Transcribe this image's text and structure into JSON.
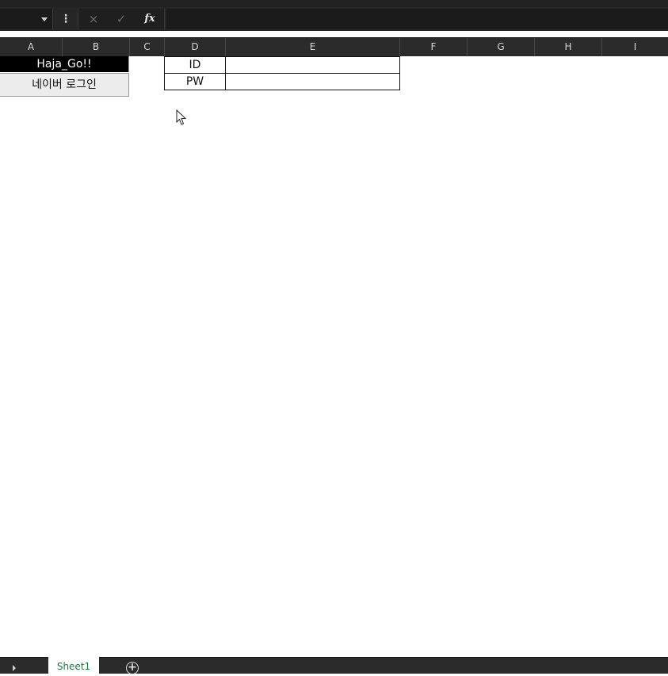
{
  "formula_bar": {
    "cancel_icon": "×",
    "enter_icon": "✓",
    "insert_function_label": "fx",
    "more_icon": "⋮",
    "name_box_value": "",
    "formula_value": ""
  },
  "columns": [
    "A",
    "B",
    "C",
    "D",
    "E",
    "F",
    "G",
    "H",
    "I"
  ],
  "sheet": {
    "button_haja": "Haja_Go!!",
    "button_naver_login": "네이버 로그인",
    "login_table": {
      "id_label": "ID",
      "pw_label": "PW",
      "id_value": "",
      "pw_value": ""
    }
  },
  "tabs": {
    "active": "Sheet1",
    "add_icon": "+"
  },
  "colors": {
    "accent": "#217346",
    "chrome_dark": "#262626",
    "button_black": "#000000"
  }
}
